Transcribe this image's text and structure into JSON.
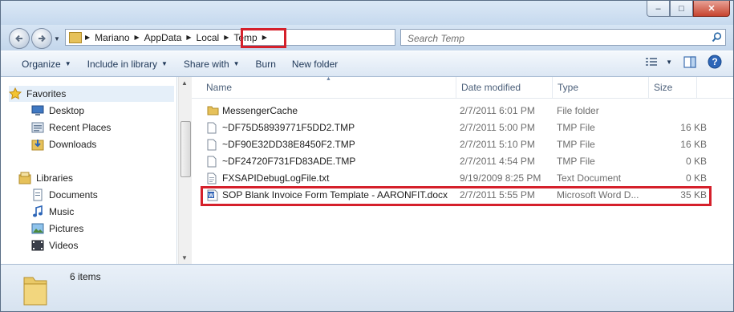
{
  "window": {
    "caption_buttons": {
      "minimize": "–",
      "maximize": "□",
      "close": "✕"
    }
  },
  "address": {
    "crumbs": [
      "Mariano",
      "AppData",
      "Local",
      "Temp"
    ],
    "highlight_color": "#d5202b"
  },
  "search": {
    "placeholder": "Search Temp"
  },
  "toolbar": {
    "organize": "Organize",
    "include": "Include in library",
    "share": "Share with",
    "burn": "Burn",
    "new_folder": "New folder"
  },
  "nav": {
    "favorites": {
      "label": "Favorites",
      "items": [
        "Desktop",
        "Recent Places",
        "Downloads"
      ]
    },
    "libraries": {
      "label": "Libraries",
      "items": [
        "Documents",
        "Music",
        "Pictures",
        "Videos"
      ]
    }
  },
  "columns": {
    "name": "Name",
    "date": "Date modified",
    "type": "Type",
    "size": "Size"
  },
  "files": [
    {
      "name": "MessengerCache",
      "date": "2/7/2011 6:01 PM",
      "type": "File folder",
      "size": "",
      "icon": "folder-icon"
    },
    {
      "name": "~DF75D58939771F5DD2.TMP",
      "date": "2/7/2011 5:00 PM",
      "type": "TMP File",
      "size": "16 KB",
      "icon": "file-icon"
    },
    {
      "name": "~DF90E32DD38E8450F2.TMP",
      "date": "2/7/2011 5:10 PM",
      "type": "TMP File",
      "size": "16 KB",
      "icon": "file-icon"
    },
    {
      "name": "~DF24720F731FD83ADE.TMP",
      "date": "2/7/2011 4:54 PM",
      "type": "TMP File",
      "size": "0 KB",
      "icon": "file-icon"
    },
    {
      "name": "FXSAPIDebugLogFile.txt",
      "date": "9/19/2009 8:25 PM",
      "type": "Text Document",
      "size": "0 KB",
      "icon": "text-file-icon"
    },
    {
      "name": "SOP Blank Invoice Form Template - AARONFIT.docx",
      "date": "2/7/2011 5:55 PM",
      "type": "Microsoft Word D...",
      "size": "35 KB",
      "icon": "word-doc-icon"
    }
  ],
  "status": {
    "count": "6 items"
  }
}
